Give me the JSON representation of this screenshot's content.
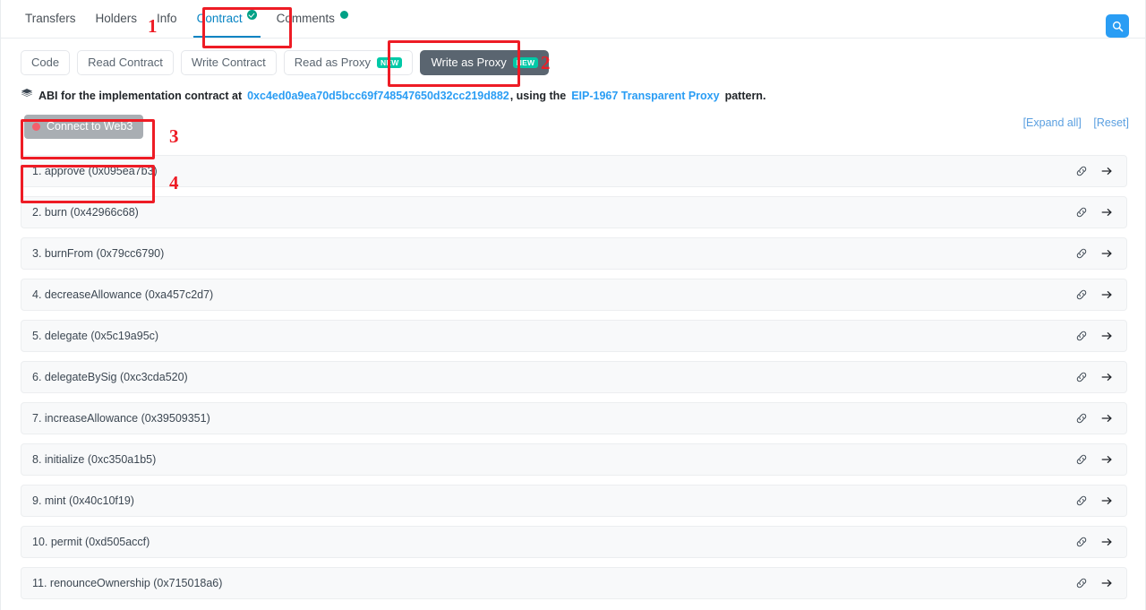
{
  "header": {
    "tabs": [
      {
        "label": "Transfers",
        "active": false,
        "marker": "none"
      },
      {
        "label": "Holders",
        "active": false,
        "marker": "none"
      },
      {
        "label": "Info",
        "active": false,
        "marker": "none"
      },
      {
        "label": "Contract",
        "active": true,
        "marker": "check"
      },
      {
        "label": "Comments",
        "active": false,
        "marker": "dot"
      }
    ],
    "search_icon": "search-icon"
  },
  "subtabs": [
    {
      "label": "Code",
      "new": false,
      "selected": false
    },
    {
      "label": "Read Contract",
      "new": false,
      "selected": false
    },
    {
      "label": "Write Contract",
      "new": false,
      "selected": false
    },
    {
      "label": "Read as Proxy",
      "new": true,
      "new_label": "NEW",
      "selected": false
    },
    {
      "label": "Write as Proxy",
      "new": true,
      "new_label": "NEW",
      "selected": true
    }
  ],
  "abi_notice": {
    "icon": "layers-icon",
    "prefix": "ABI for the implementation contract at",
    "address": "0xc4ed0a9ea70d5bcc69f748547650d32cc219d882",
    "middle": ", using the",
    "pattern_link": "EIP-1967 Transparent Proxy",
    "suffix": "pattern."
  },
  "connect": {
    "button_label": "Connect to Web3",
    "status_dot_color": "#f4606c",
    "expand_all": "[Expand all]",
    "reset": "[Reset]"
  },
  "functions": [
    {
      "label": "1. approve (0x095ea7b3)"
    },
    {
      "label": "2. burn (0x42966c68)"
    },
    {
      "label": "3. burnFrom (0x79cc6790)"
    },
    {
      "label": "4. decreaseAllowance (0xa457c2d7)"
    },
    {
      "label": "5. delegate (0x5c19a95c)"
    },
    {
      "label": "6. delegateBySig (0xc3cda520)"
    },
    {
      "label": "7. increaseAllowance (0x39509351)"
    },
    {
      "label": "8. initialize (0xc350a1b5)"
    },
    {
      "label": "9. mint (0x40c10f19)"
    },
    {
      "label": "10. permit (0xd505accf)"
    },
    {
      "label": "11. renounceOwnership (0x715018a6)"
    }
  ],
  "row_icons": {
    "link": "link-icon",
    "arrow": "arrow-right-icon"
  },
  "annotations": [
    {
      "number": "1"
    },
    {
      "number": "2"
    },
    {
      "number": "3"
    },
    {
      "number": "4"
    }
  ],
  "colors": {
    "accent_blue": "#2a9df4",
    "active_tab": "#0784c3",
    "annotation_red": "#ee1c25",
    "new_badge_green": "#00c9a7",
    "status_green": "#00a186",
    "dark_button": "#5a6570"
  }
}
